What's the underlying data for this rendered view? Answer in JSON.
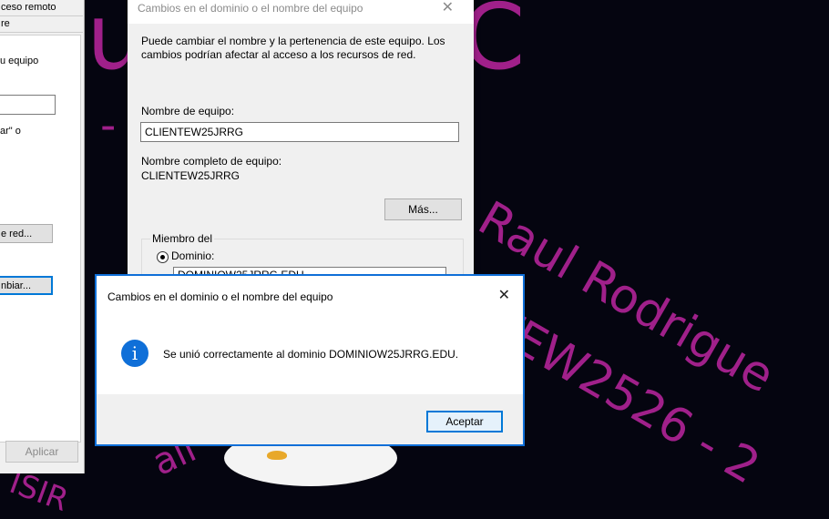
{
  "wallpaper": {
    "big_text": "u   iguez  C",
    "diag_line_1": "Raul Rodrigue",
    "diag_line_2": "TEW2526 - 2",
    "fragment_1": "all",
    "fragment_2": "ISIR",
    "dash": "-"
  },
  "system_properties": {
    "tabs": [
      "ceso remoto",
      "re"
    ],
    "texts": [
      "u equipo",
      "ar\" o"
    ],
    "network_button_label": "e red...",
    "change_button_label": "nbiar...",
    "apply_label": "Aplicar"
  },
  "name_changes_dialog": {
    "title": "Cambios en el dominio o el nombre del equipo",
    "description": "Puede cambiar el nombre y la pertenencia de este equipo. Los cambios podrían afectar al acceso a los recursos de red.",
    "computer_name_label": "Nombre de equipo:",
    "computer_name_value": "CLIENTEW25JRRG",
    "full_name_label": "Nombre completo de equipo:",
    "full_name_value": "CLIENTEW25JRRG",
    "more_button": "Más...",
    "member_of_label": "Miembro del",
    "domain_radio_label": "Dominio:",
    "domain_value": "DOMINIOW25JRRG.EDU"
  },
  "message_box": {
    "title": "Cambios en el dominio o el nombre del equipo",
    "message": "Se unió correctamente al dominio DOMINIOW25JRRG.EDU.",
    "ok_button": "Aceptar",
    "icon": "information-icon",
    "accent_color": "#0078d7"
  }
}
